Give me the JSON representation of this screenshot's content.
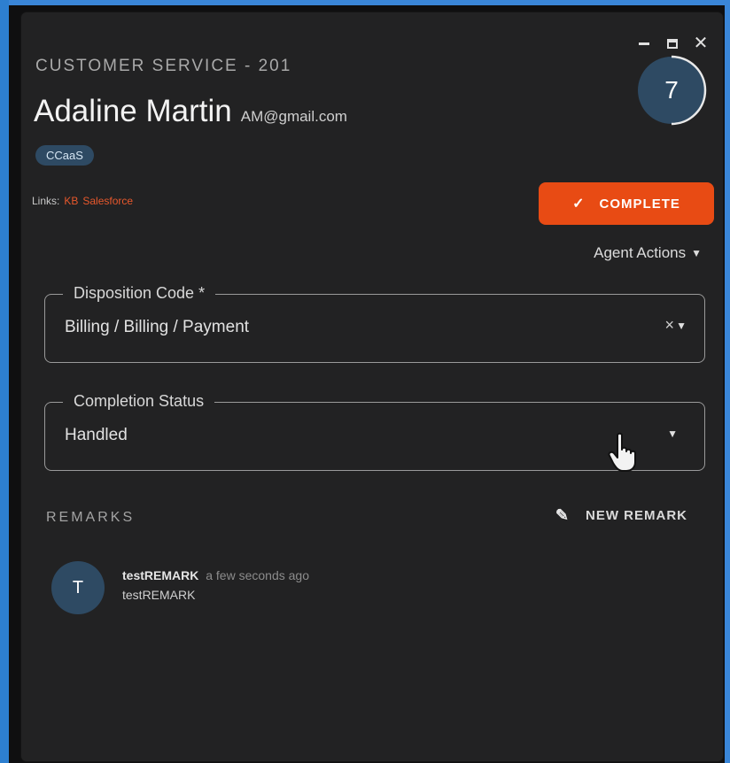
{
  "window": {
    "queue_title": "CUSTOMER SERVICE - 201",
    "counter": "7",
    "controls": {
      "minimize": "minimize-icon",
      "maximize": "maximize-icon",
      "close": "✕"
    }
  },
  "customer": {
    "name": "Adaline Martin",
    "email": "AM@gmail.com",
    "tag": "CCaaS"
  },
  "links": {
    "label": "Links:",
    "items": [
      "KB",
      "Salesforce"
    ]
  },
  "actions": {
    "complete_label": "COMPLETE",
    "agent_actions_label": "Agent Actions"
  },
  "disposition": {
    "legend": "Disposition Code *",
    "value": "Billing / Billing / Payment",
    "clear": "×"
  },
  "completion": {
    "legend": "Completion Status",
    "value": "Handled"
  },
  "remarks": {
    "header": "REMARKS",
    "new_label": "NEW REMARK",
    "items": [
      {
        "avatar": "T",
        "author": "testREMARK",
        "time": "a few seconds ago",
        "text": "testREMARK"
      }
    ]
  },
  "colors": {
    "accent": "#e84b14",
    "badge": "#2e4a63",
    "frame": "#3a86d8",
    "panel": "#222223"
  }
}
